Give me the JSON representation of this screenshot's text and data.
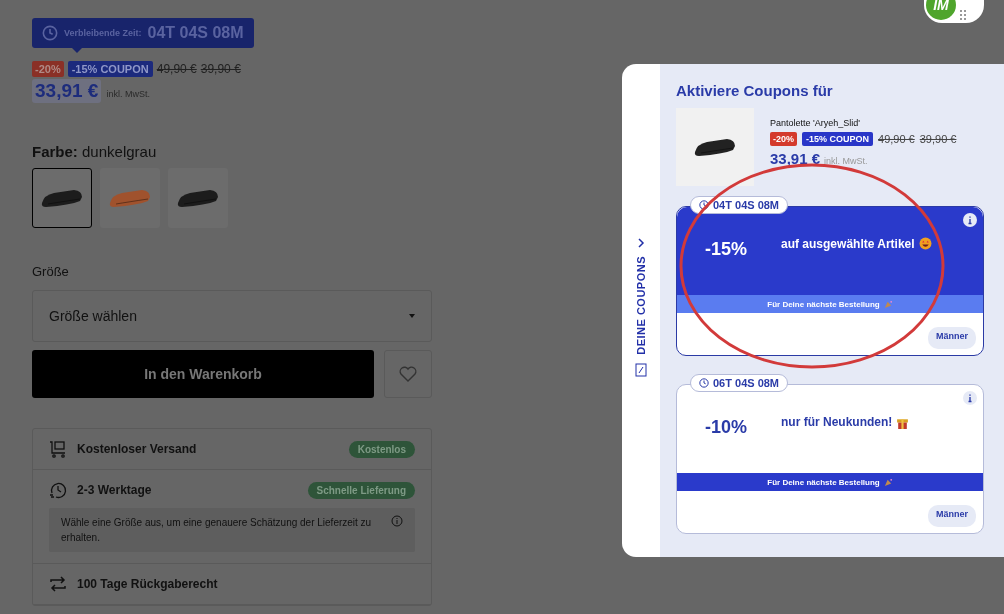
{
  "timer": {
    "label": "Verbleibende Zeit:",
    "value": "04T 04S 08M"
  },
  "price": {
    "discount": "-20%",
    "coupon": "-15% COUPON",
    "old_prices": [
      "49,90 €",
      "39,90 €"
    ],
    "current": "33,91 €",
    "tax_note": "inkl. MwSt."
  },
  "color": {
    "label": "Farbe:",
    "value": "dunkelgrau",
    "swatches": [
      {
        "color": "#1c1c1c",
        "selected": true
      },
      {
        "color": "#a0522d",
        "selected": false
      },
      {
        "color": "#1c1c1c",
        "selected": false
      }
    ]
  },
  "size": {
    "label": "Größe",
    "placeholder": "Größe wählen"
  },
  "cart_button": "In den Warenkorb",
  "delivery": [
    {
      "kind": "shipping",
      "title": "Kostenloser Versand",
      "badge": "Kostenlos"
    },
    {
      "kind": "time",
      "title": "2-3 Werktage",
      "badge": "Schnelle Lieferung",
      "note": "Wähle eine Größe aus, um eine genauere Schätzung der Lieferzeit zu erhalten."
    },
    {
      "kind": "returns",
      "title": "100 Tage Rückgaberecht"
    }
  ],
  "logo": {
    "text": "IM"
  },
  "coupon_panel": {
    "tab_label": "DEINE COUPONS",
    "title": "Aktiviere Coupons für",
    "product": {
      "name": "Pantolette 'Aryeh_Slid'",
      "discount": "-20%",
      "coupon": "-15% COUPON",
      "old_prices": [
        "49,90 €",
        "39,90 €"
      ],
      "current": "33,91 €",
      "tax_note": "inkl. MwSt."
    },
    "coupons": [
      {
        "timer": "04T 04S 08M",
        "amount": "-15%",
        "text": "auf ausgewählte Artikel",
        "kind": "face",
        "selected": true,
        "footer": "Für Deine nächste Bestellung",
        "tag": "Männer"
      },
      {
        "timer": "06T 04S 08M",
        "amount": "-10%",
        "text": "nur für Neukunden!",
        "kind": "gift",
        "selected": false,
        "footer": "Für Deine nächste Bestellung",
        "tag": "Männer"
      }
    ]
  }
}
